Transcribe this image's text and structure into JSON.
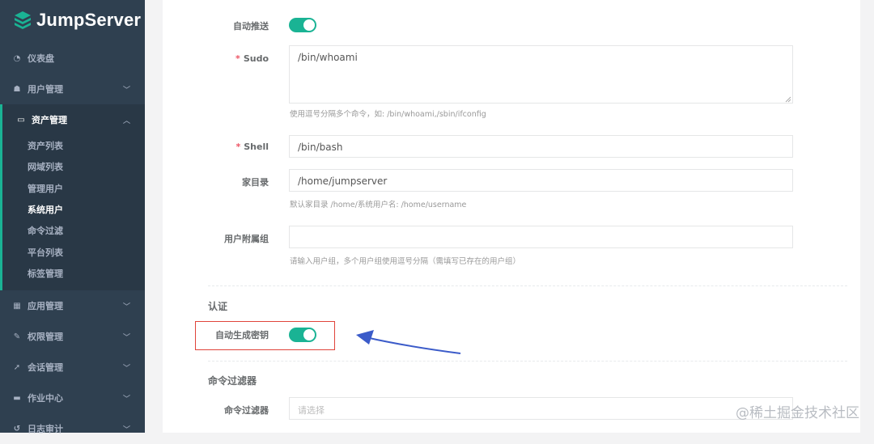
{
  "app": {
    "logo_text": "JumpServer"
  },
  "sidebar": {
    "items": [
      {
        "label": "仪表盘",
        "icon": "dashboard-icon"
      },
      {
        "label": "用户管理",
        "icon": "users-icon"
      },
      {
        "label": "资产管理",
        "icon": "inbox-icon"
      },
      {
        "label": "应用管理",
        "icon": "grid-icon"
      },
      {
        "label": "权限管理",
        "icon": "edit-icon"
      },
      {
        "label": "会话管理",
        "icon": "rocket-icon"
      },
      {
        "label": "作业中心",
        "icon": "terminal-icon"
      },
      {
        "label": "日志审计",
        "icon": "history-icon"
      }
    ],
    "sub_items": [
      "资产列表",
      "网域列表",
      "管理用户",
      "系统用户",
      "命令过滤",
      "平台列表",
      "标签管理"
    ],
    "current_sub": "系统用户"
  },
  "form": {
    "auto_push_label": "自动推送",
    "auto_push_on": true,
    "sudo_label": "Sudo",
    "sudo_value": "/bin/whoami",
    "sudo_help": "使用逗号分隔多个命令，如: /bin/whoami,/sbin/ifconfig",
    "shell_label": "Shell",
    "shell_value": "/bin/bash",
    "home_label": "家目录",
    "home_value": "/home/jumpserver",
    "home_help": "默认家目录 /home/系统用户名: /home/username",
    "groups_label": "用户附属组",
    "groups_value": "",
    "groups_help": "请输入用户组，多个用户组使用逗号分隔（需填写已存在的用户组）",
    "auth_section": "认证",
    "auto_key_label": "自动生成密钥",
    "auto_key_on": true,
    "filter_section": "命令过滤器",
    "filter_label": "命令过滤器",
    "filter_placeholder": "请选择"
  },
  "watermark": "@稀土掘金技术社区",
  "colors": {
    "accent": "#1ab394",
    "sidebar": "#2f4050",
    "highlight": "#e0443a",
    "arrow": "#3b5bc9"
  }
}
